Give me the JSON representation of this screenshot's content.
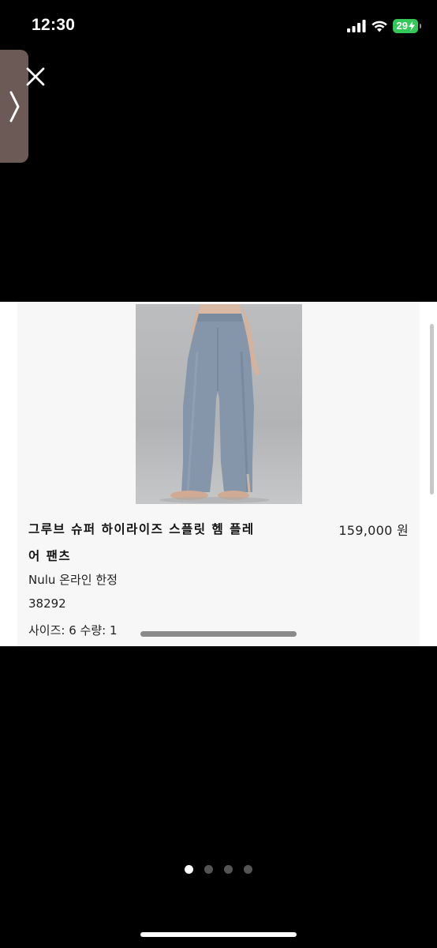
{
  "status_bar": {
    "time": "12:30",
    "battery": "29",
    "icons": [
      "cellular-signal-icon",
      "wifi-icon",
      "battery-charging-icon"
    ],
    "battery_color": "#34c759"
  },
  "controls": {
    "side_tab_icon": "chevron-right-icon",
    "close_icon": "close-icon"
  },
  "product": {
    "title_line1": "그루브 슈퍼 하이라이즈 스플릿 헴 플레",
    "title_line2": "어 팬츠",
    "price": "159,000 원",
    "edition": "Nulu 온라인 한정",
    "code": "38292",
    "size_qty": "사이즈: 6 수량: 1",
    "image_subject": "grey-blue flared leggings on model"
  },
  "pagination": {
    "total": 4,
    "active_index": 0
  }
}
